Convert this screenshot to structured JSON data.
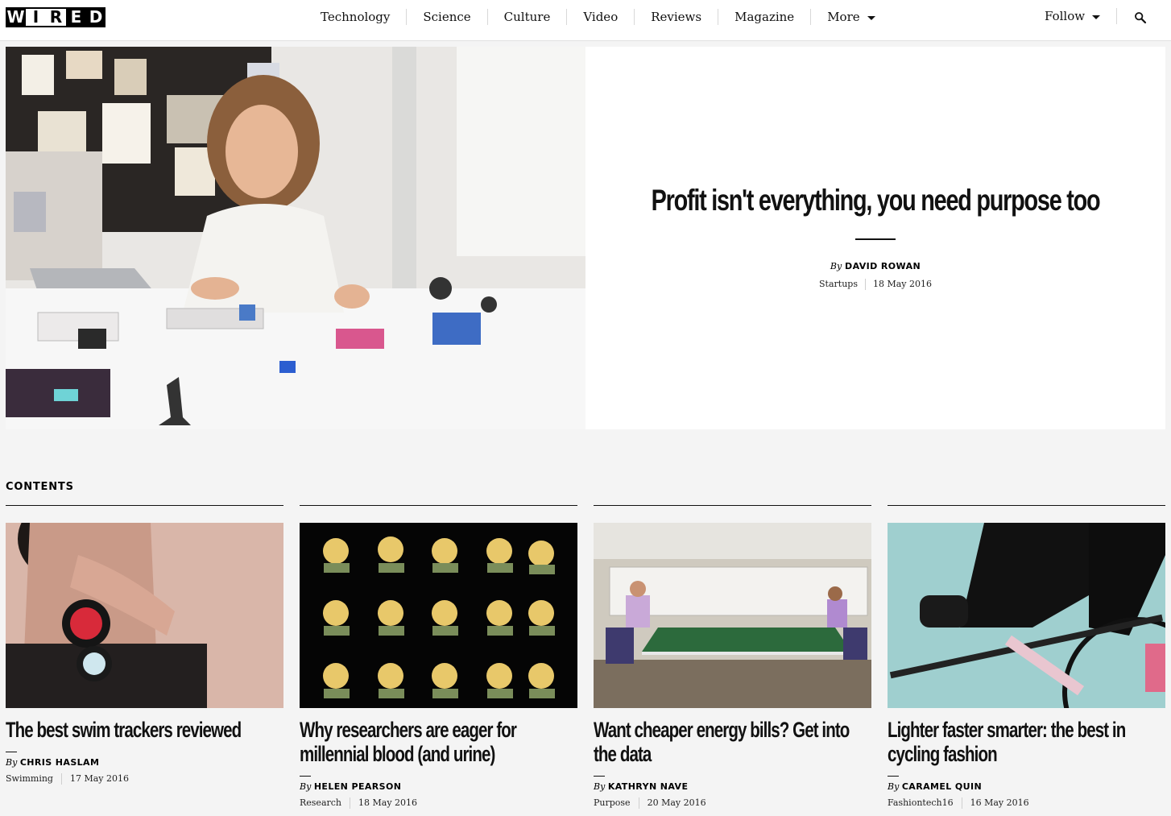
{
  "nav": {
    "logo": [
      "W",
      "I",
      "R",
      "E",
      "D"
    ],
    "items": [
      {
        "label": "Technology"
      },
      {
        "label": "Science"
      },
      {
        "label": "Culture"
      },
      {
        "label": "Video"
      },
      {
        "label": "Reviews"
      },
      {
        "label": "Magazine"
      },
      {
        "label": "More",
        "has_dropdown": true
      }
    ],
    "follow_label": "Follow",
    "search_icon": "search-icon"
  },
  "hero": {
    "title": "Profit isn't everything, you need purpose too",
    "by_label": "By",
    "author": "DAVID ROWAN",
    "category": "Startups",
    "date": "18 May 2016",
    "image": "woman-with-electronic-kits-photo"
  },
  "contents": {
    "label": "CONTENTS",
    "cards": [
      {
        "title": "The best swim trackers reviewed",
        "by_label": "By",
        "author": "CHRIS HASLAM",
        "category": "Swimming",
        "date": "17 May 2016",
        "image": "swimmer-wearing-fitness-trackers-photo"
      },
      {
        "title": "Why researchers are eager for millennial blood (and urine)",
        "by_label": "By",
        "author": "HELEN PEARSON",
        "category": "Research",
        "date": "18 May 2016",
        "image": "illustrated-portraits-grid"
      },
      {
        "title": "Want cheaper energy bills? Get into the data",
        "by_label": "By",
        "author": "KATHRYN NAVE",
        "category": "Purpose",
        "date": "20 May 2016",
        "image": "office-ping-pong-photo"
      },
      {
        "title": "Lighter faster smarter: the best in cycling fashion",
        "by_label": "By",
        "author": "CARAMEL QUIN",
        "category": "Fashiontech16",
        "date": "16 May 2016",
        "image": "cyclist-on-bike-photo"
      }
    ]
  }
}
